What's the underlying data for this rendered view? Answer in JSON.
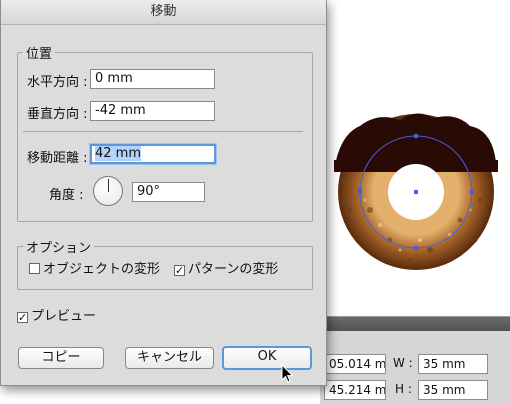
{
  "dialog": {
    "title": "移動",
    "position_group": {
      "title": "位置",
      "horizontal_label": "水平方向 :",
      "horizontal_value": "0 mm",
      "vertical_label": "垂直方向 :",
      "vertical_value": "-42 mm",
      "distance_label": "移動距離 :",
      "distance_value": "42 mm",
      "angle_label": "角度 :",
      "angle_value": "90°"
    },
    "options_group": {
      "title": "オプション",
      "transform_objects": "オブジェクトの変形",
      "transform_objects_checked": false,
      "transform_patterns": "パターンの変形",
      "transform_patterns_checked": true
    },
    "preview_label": "プレビュー",
    "preview_checked": true,
    "buttons": {
      "copy": "コピー",
      "cancel": "キャンセル",
      "ok": "OK"
    }
  },
  "transform_panel": {
    "x_value": "05.014 m",
    "y_value": "45.214 m",
    "w_label": "W :",
    "w_value": "35 mm",
    "h_label": "H :",
    "h_value": "35 mm"
  },
  "colors": {
    "accent_focus": "#5e97d8",
    "selection_bounds": "#3d63e0",
    "donut_chocolate": "#2a0a05",
    "donut_dough": "#b77a3a"
  },
  "icons": [
    "angle-dial-icon",
    "checkbox-icon",
    "mouse-pointer-icon"
  ]
}
